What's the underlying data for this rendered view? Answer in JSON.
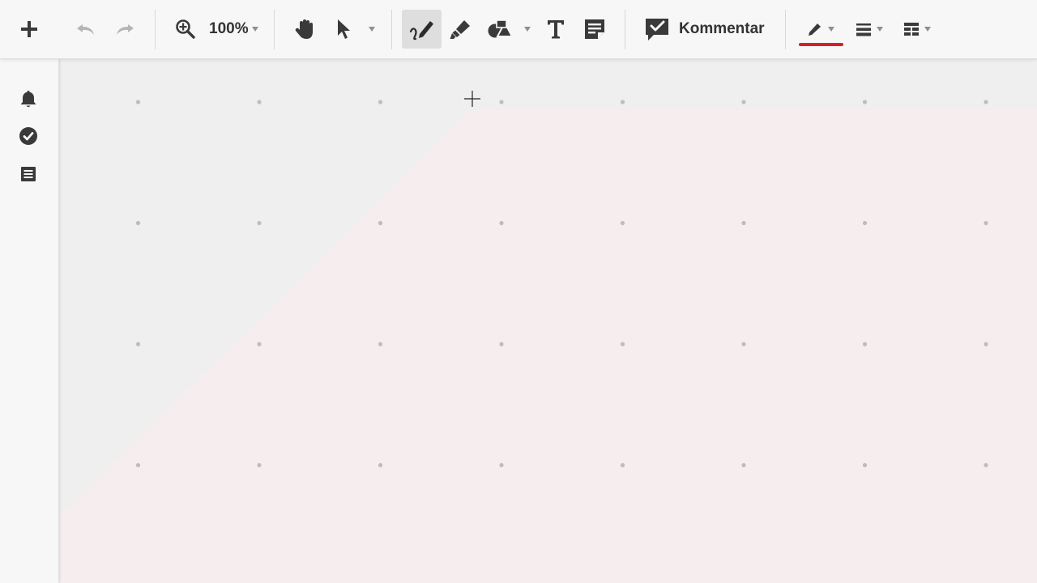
{
  "toolbar": {
    "zoom_level": "100%",
    "comment_label": "Kommentar",
    "active_tool": "pen",
    "pen_color": "#d0212b"
  },
  "sidebar": {
    "items": [
      "bell-icon",
      "check-circle-icon",
      "list-icon"
    ]
  },
  "canvas": {
    "background": "#efefef",
    "page_color": "#f6eeee",
    "grid": true
  }
}
